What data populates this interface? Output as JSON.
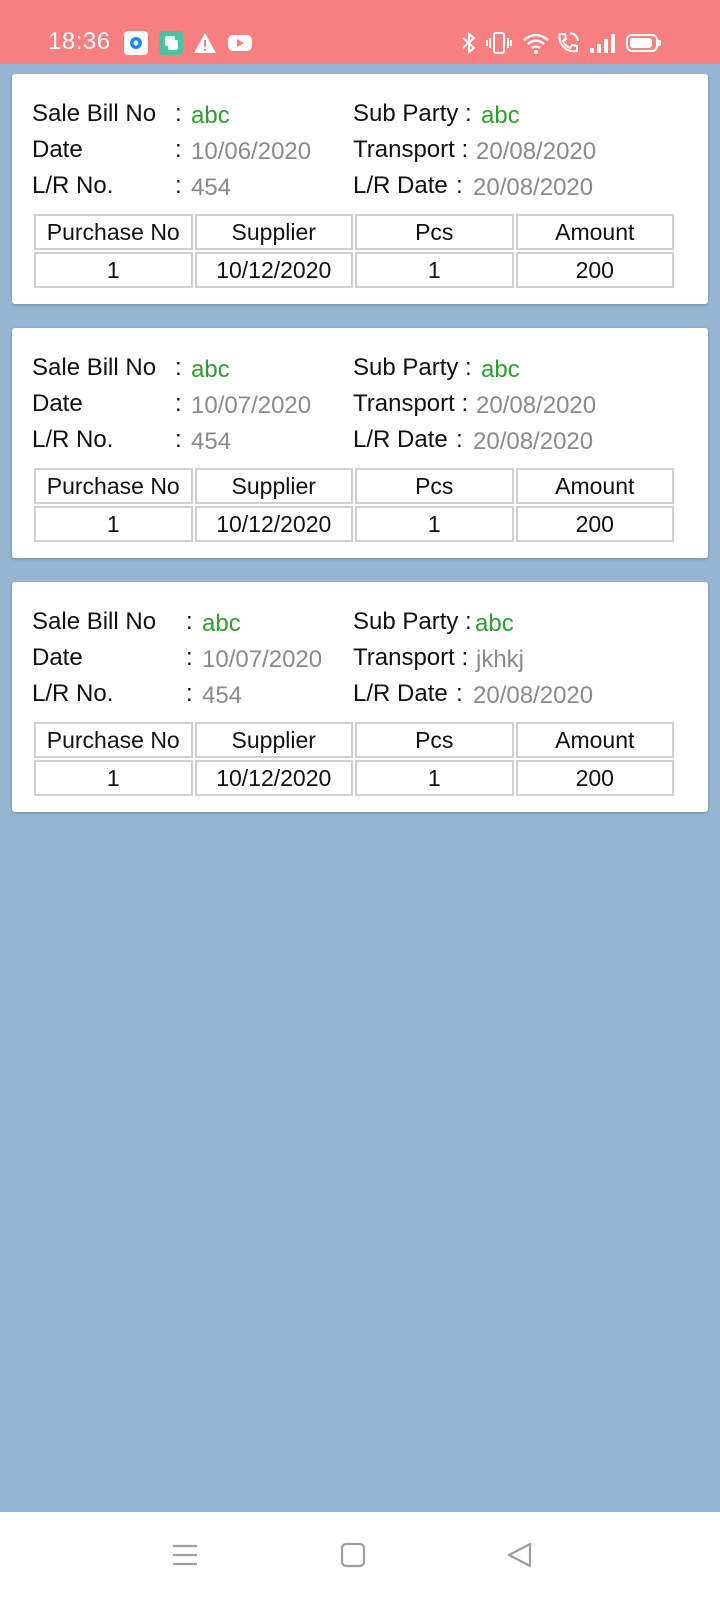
{
  "status_bar": {
    "time": "18:36",
    "left_icons": [
      "location-app-icon",
      "chat-app-icon",
      "warning-icon",
      "youtube-icon"
    ],
    "right_icons": [
      "bluetooth-icon",
      "vibrate-icon",
      "wifi-icon",
      "wifi-calling-icon",
      "signal-icon",
      "battery-icon"
    ],
    "background_color": "#f77f7f"
  },
  "labels": {
    "sale_bill_no": "Sale Bill No",
    "date": "Date",
    "lr_no": "L/R No.",
    "sub_party": "Sub Party :",
    "transport": "Transport :",
    "lr_date": "L/R Date",
    "colon": ":"
  },
  "table_headers": [
    "Purchase No",
    "Supplier",
    "Pcs",
    "Amount"
  ],
  "cards": [
    {
      "sale_bill_no": "abc",
      "date": "10/06/2020",
      "lr_no": "454",
      "sub_party": "abc",
      "transport": "20/08/2020",
      "lr_date": "20/08/2020",
      "rows": [
        [
          "1",
          "10/12/2020",
          "1",
          "200"
        ]
      ]
    },
    {
      "sale_bill_no": "abc",
      "date": "10/07/2020",
      "lr_no": "454",
      "sub_party": "abc",
      "transport": "20/08/2020",
      "lr_date": "20/08/2020",
      "rows": [
        [
          "1",
          "10/12/2020",
          "1",
          "200"
        ]
      ]
    },
    {
      "sale_bill_no": "abc",
      "date": "10/07/2020",
      "lr_no": "454",
      "sub_party": "abc",
      "transport": "jkhkj",
      "lr_date": "20/08/2020",
      "rows": [
        [
          "1",
          "10/12/2020",
          "1",
          "200"
        ]
      ]
    }
  ],
  "nav_bar": {
    "buttons": [
      "menu-icon",
      "home-icon",
      "back-icon"
    ]
  },
  "colors": {
    "page_background": "#96b6d3",
    "value_green": "#2ca02c",
    "value_gray": "#8a8a8a"
  }
}
